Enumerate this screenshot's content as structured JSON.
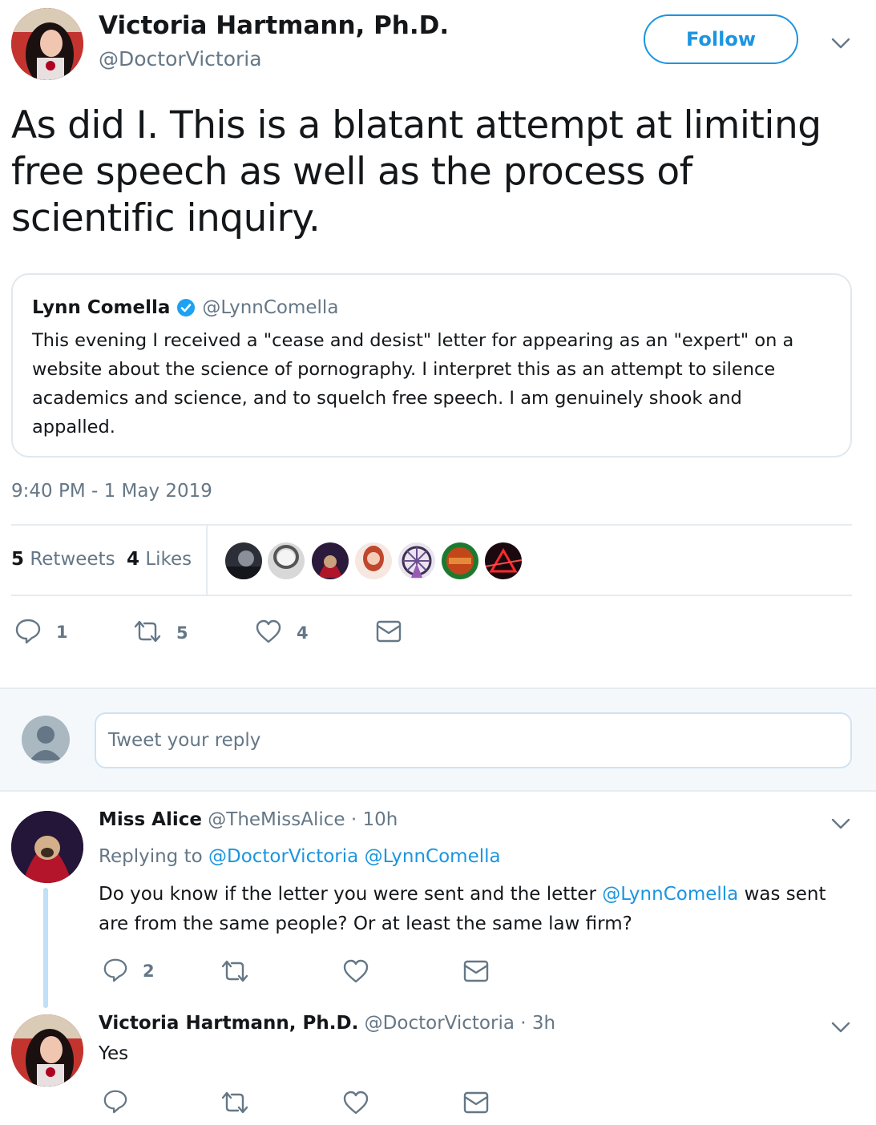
{
  "main_tweet": {
    "author_name": "Victoria Hartmann, Ph.D.",
    "author_handle": "@DoctorVictoria",
    "follow_label": "Follow",
    "text": "As did I. This is a blatant attempt at limiting free speech as well as the process of scientific inquiry.",
    "timestamp": "9:40 PM - 1 May 2019",
    "stats": {
      "retweets_count": "5",
      "retweets_label": "Retweets",
      "likes_count": "4",
      "likes_label": "Likes"
    },
    "actions": {
      "reply_count": "1",
      "retweet_count": "5",
      "like_count": "4"
    }
  },
  "quoted_tweet": {
    "author_name": "Lynn Comella",
    "author_handle": "@LynnComella",
    "verified": true,
    "text": "This evening I received a \"cease and desist\" letter for appearing as an \"expert\" on a website about the science of pornography. I interpret this as an attempt to silence academics and science, and to squelch free speech. I am genuinely shook and appalled."
  },
  "reply_box": {
    "placeholder": "Tweet your reply"
  },
  "replies": [
    {
      "author_name": "Miss Alice",
      "author_handle": "@TheMissAlice",
      "time": "· 10h",
      "replying_label": "Replying to",
      "replying_mentions": "@DoctorVictoria @LynnComella",
      "text_before": "Do you know if the letter you were sent and the letter",
      "text_mention": "@LynnComella",
      "text_after": "was sent are from the same people? Or at least the same law firm?",
      "reply_count": "2"
    },
    {
      "author_name": "Victoria Hartmann, Ph.D.",
      "author_handle": "@DoctorVictoria",
      "time": "· 3h",
      "text": "Yes"
    }
  ],
  "colors": {
    "accent": "#1b95e0",
    "muted": "#657786",
    "border": "#e6ecf0",
    "reply_bg": "#f5f8fa"
  }
}
